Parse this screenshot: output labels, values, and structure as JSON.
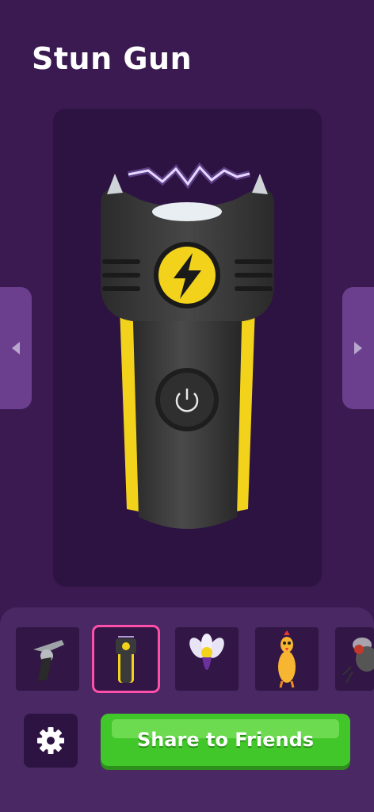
{
  "header": {
    "title": "Stun Gun"
  },
  "device": {
    "name": "stun-gun",
    "colors": {
      "body": "#3a3a3a",
      "accent": "#f2d21b",
      "spark": "#ffffff"
    }
  },
  "navigation": {
    "prev_icon": "chevron-left-icon",
    "next_icon": "chevron-right-icon"
  },
  "items": [
    {
      "name": "revolver",
      "icon": "revolver-icon",
      "selected": false
    },
    {
      "name": "stun-gun",
      "icon": "stun-gun-icon",
      "selected": true
    },
    {
      "name": "flower-monster",
      "icon": "flower-icon",
      "selected": false
    },
    {
      "name": "rubber-chicken",
      "icon": "chicken-icon",
      "selected": false
    },
    {
      "name": "fly",
      "icon": "fly-icon",
      "selected": false
    }
  ],
  "footer": {
    "settings_icon": "gear-icon",
    "share_label": "Share to Friends",
    "share_color": "#42c72a"
  }
}
